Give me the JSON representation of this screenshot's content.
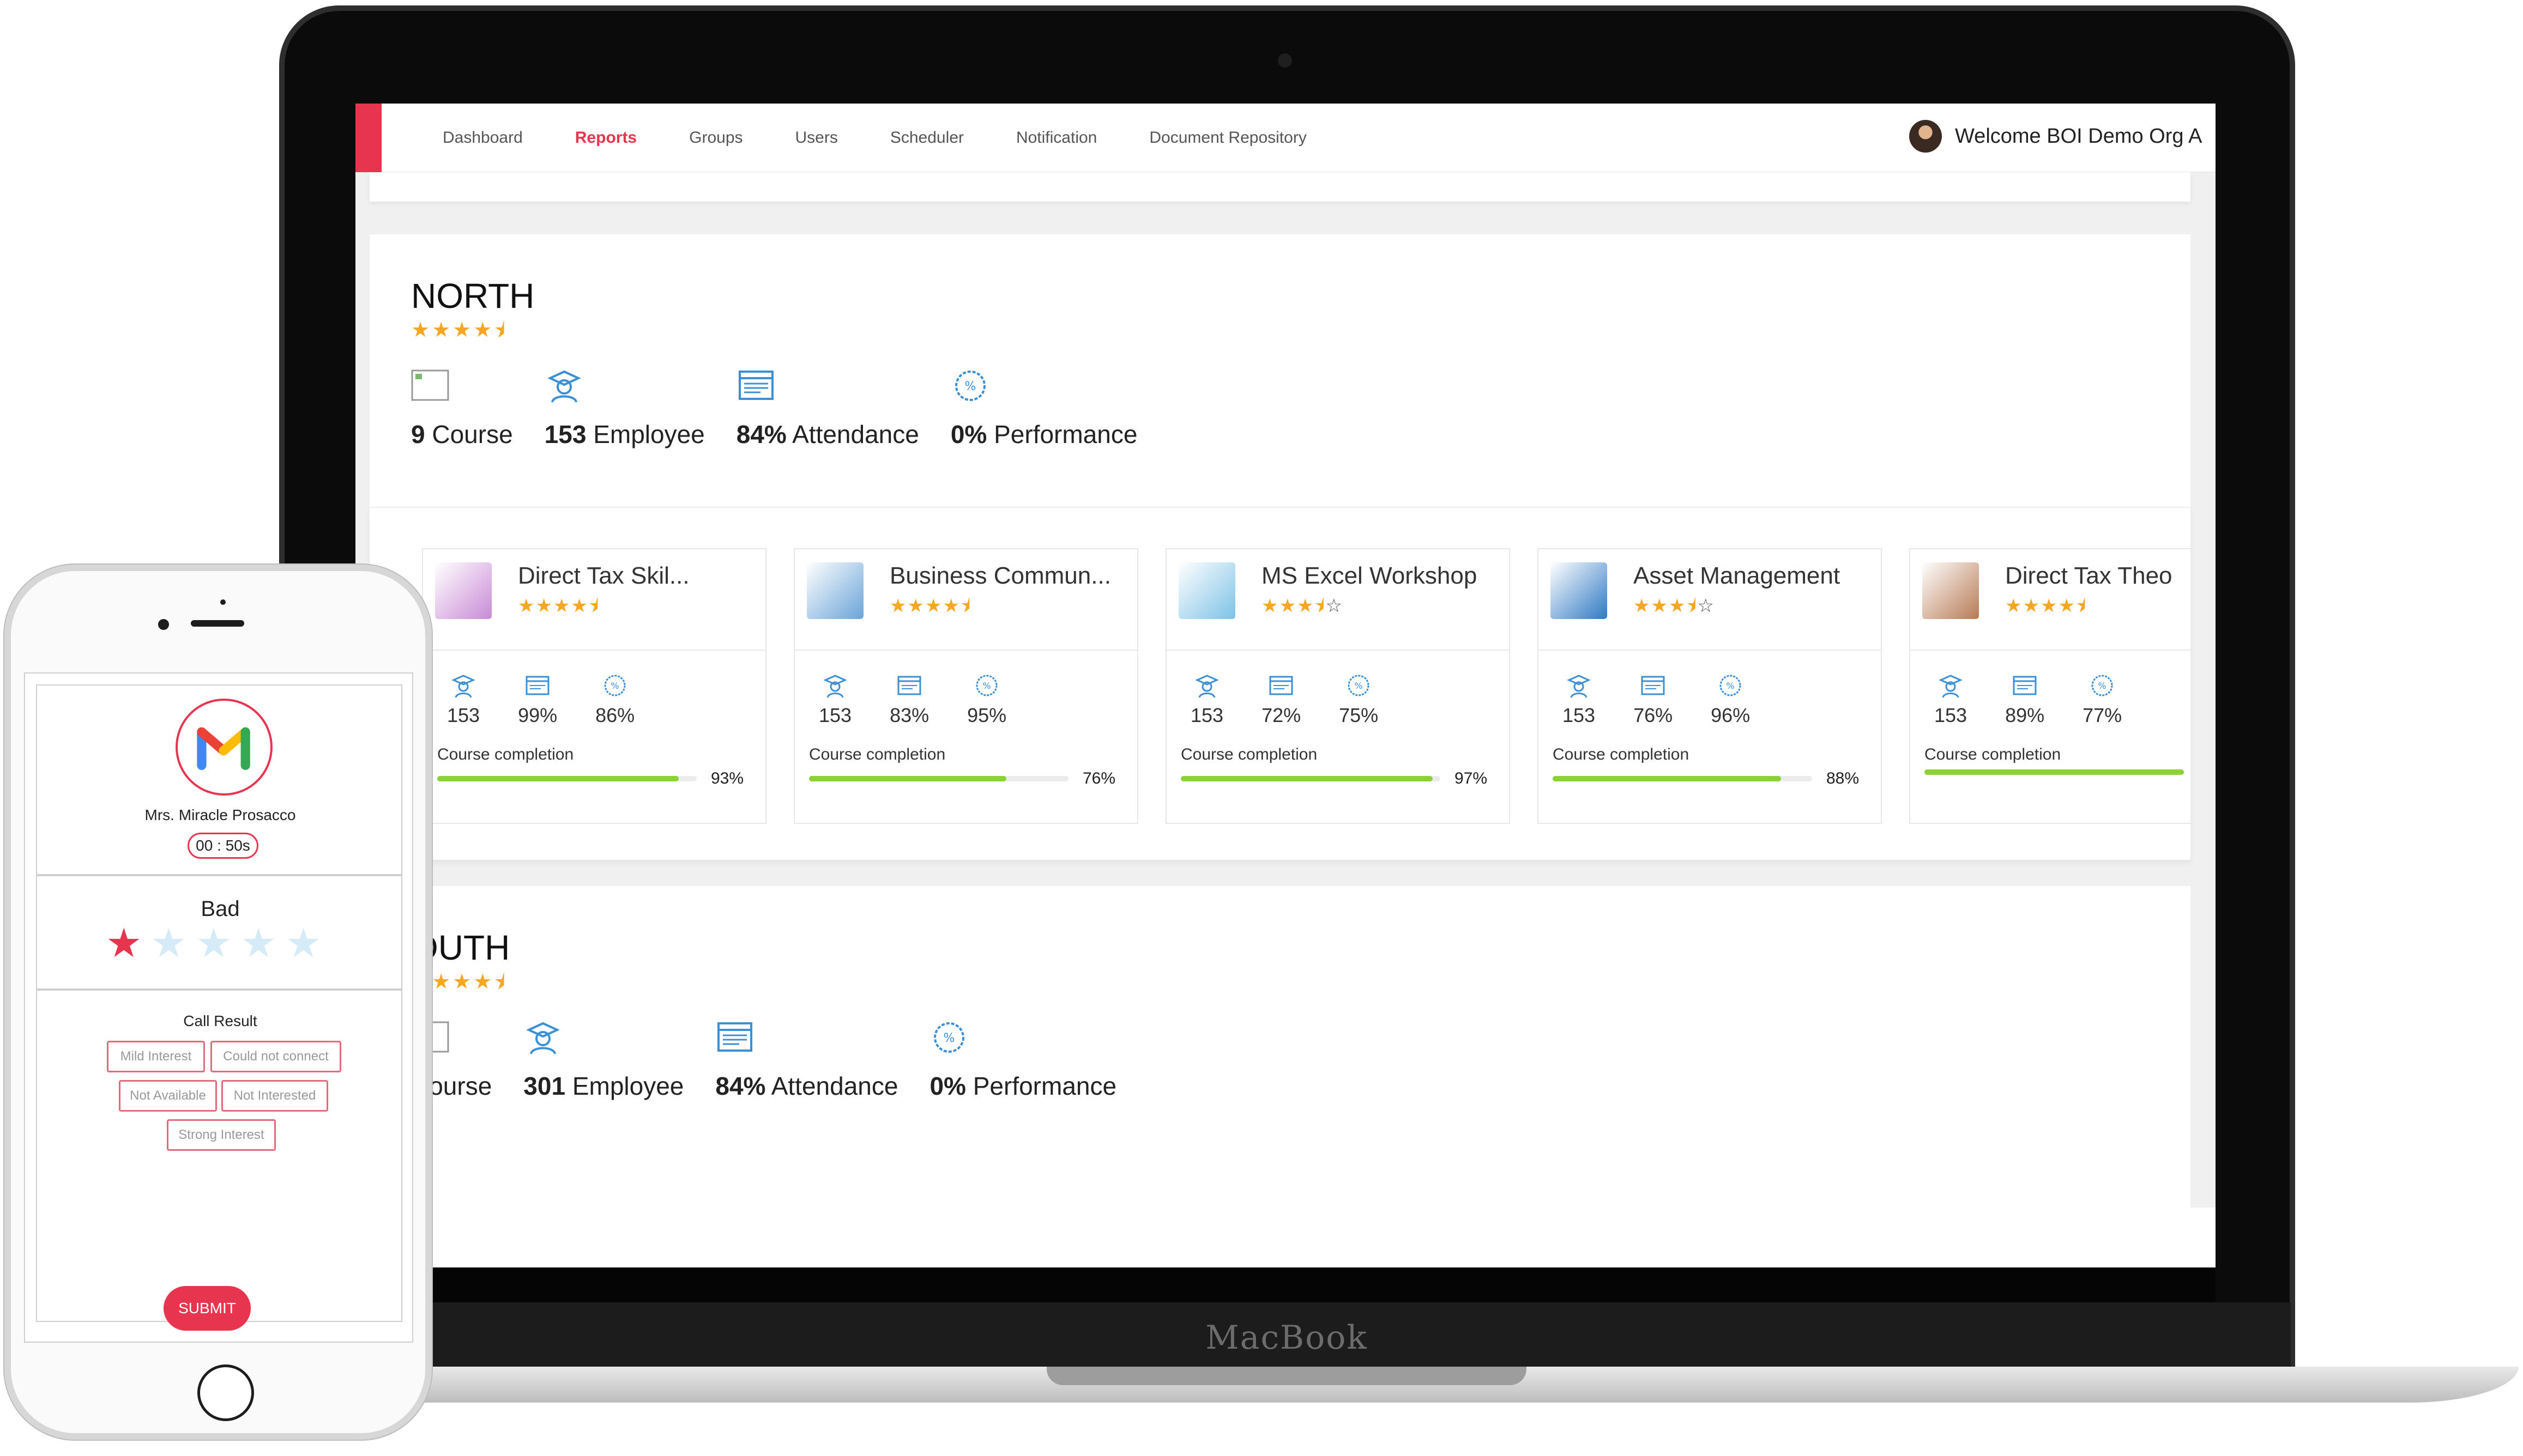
{
  "nav": {
    "items": [
      "Dashboard",
      "Reports",
      "Groups",
      "Users",
      "Scheduler",
      "Notification",
      "Document Repository"
    ],
    "active": "Reports",
    "welcome": "Welcome BOI Demo Org A"
  },
  "regions": [
    {
      "name": "NORTH",
      "rating": 4.5,
      "course_count": "9",
      "course_label": "Course",
      "employee_count": "153",
      "employee_label": "Employee",
      "attendance": "84%",
      "attendance_label": "Attendance",
      "performance": "0%",
      "performance_label": "Performance"
    },
    {
      "name": "OUTH",
      "rating": 4.5,
      "course_count": "",
      "course_label": "Course",
      "employee_count": "301",
      "employee_label": "Employee",
      "attendance": "84%",
      "attendance_label": "Attendance",
      "performance": "0%",
      "performance_label": "Performance"
    }
  ],
  "courses": [
    {
      "title": "Direct Tax Skil...",
      "rating": 4.5,
      "employees": "153",
      "attendance": "99%",
      "performance": "86%",
      "completion_label": "Course completion",
      "completion": "93%",
      "completion_value": 93,
      "thumb_color": "#c98bd6"
    },
    {
      "title": "Business Commun...",
      "rating": 4.5,
      "employees": "153",
      "attendance": "83%",
      "performance": "95%",
      "completion_label": "Course completion",
      "completion": "76%",
      "completion_value": 76,
      "thumb_color": "#6aa4d8"
    },
    {
      "title": "MS Excel Workshop",
      "rating": 3.5,
      "employees": "153",
      "attendance": "72%",
      "performance": "75%",
      "completion_label": "Course completion",
      "completion": "97%",
      "completion_value": 97,
      "thumb_color": "#7cc2e6"
    },
    {
      "title": "Asset Management",
      "rating": 3.5,
      "employees": "153",
      "attendance": "76%",
      "performance": "96%",
      "completion_label": "Course completion",
      "completion": "88%",
      "completion_value": 88,
      "thumb_color": "#2f79c4"
    },
    {
      "title": "Direct Tax Theo",
      "rating": 4.5,
      "employees": "153",
      "attendance": "89%",
      "performance": "77%",
      "completion_label": "Course completion",
      "completion": "",
      "completion_value": 100,
      "thumb_color": "#b87a54"
    }
  ],
  "device": {
    "brand": "MacBook"
  },
  "phone": {
    "contact_name": "Mrs. Miracle Prosacco",
    "timer": "00 : 50s",
    "rating_label": "Bad",
    "rating": 1,
    "call_result_label": "Call Result",
    "chips": [
      "Mild Interest",
      "Could not connect",
      "Not Available",
      "Not Interested",
      "Strong Interest"
    ],
    "submit_label": "SUBMIT"
  },
  "colors": {
    "accent": "#e8354f",
    "star": "#f5a623",
    "progress": "#8bd234",
    "icon": "#3b8fd4"
  }
}
